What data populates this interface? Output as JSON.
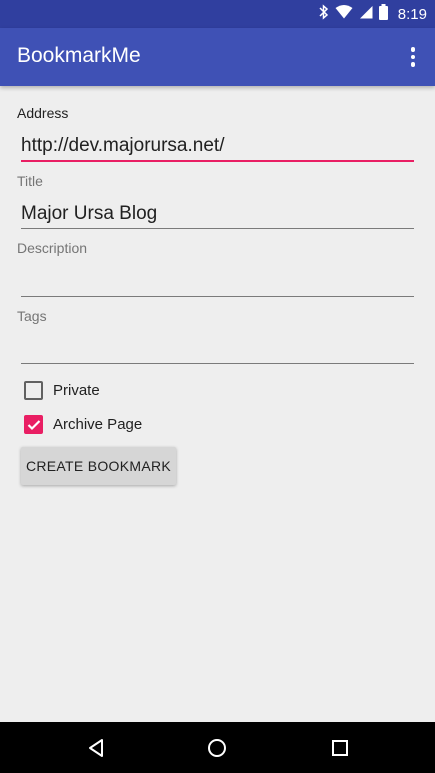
{
  "status_bar": {
    "time": "8:19",
    "icons": [
      "bluetooth-icon",
      "wifi-icon",
      "signal-icon",
      "battery-icon"
    ]
  },
  "app_bar": {
    "title": "BookmarkMe",
    "overflow_icon": "more-vert-icon"
  },
  "form": {
    "address": {
      "label": "Address",
      "value": "http://dev.majorursa.net/"
    },
    "title": {
      "label": "Title",
      "value": "Major Ursa Blog"
    },
    "description": {
      "label": "Description",
      "value": ""
    },
    "tags": {
      "label": "Tags",
      "value": ""
    },
    "private": {
      "label": "Private",
      "checked": false
    },
    "archive": {
      "label": "Archive Page",
      "checked": true
    },
    "create_button": "CREATE BOOKMARK"
  },
  "nav_bar": {
    "back_icon": "back-triangle-icon",
    "home_icon": "home-circle-icon",
    "recents_icon": "recents-square-icon"
  },
  "colors": {
    "primary": "#3f51b5",
    "primary_dark": "#303f9f",
    "accent": "#e91e63",
    "background": "#eeeeee"
  }
}
